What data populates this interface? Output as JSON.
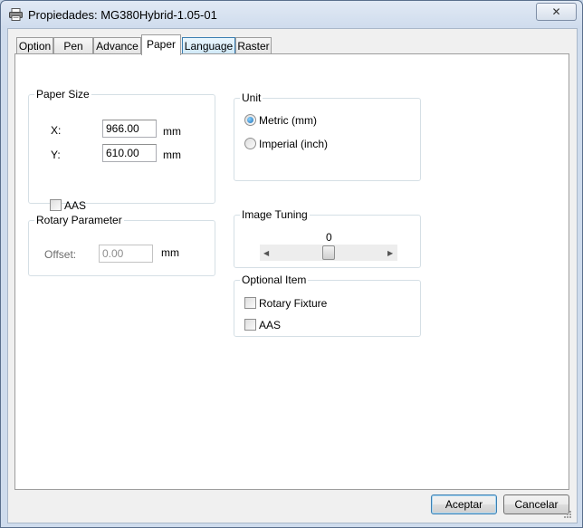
{
  "window": {
    "title": "Propiedades: MG380Hybrid-1.05-01",
    "close_glyph": "✕"
  },
  "tabs": [
    {
      "label": "Option",
      "active": false
    },
    {
      "label": "Pen",
      "active": false
    },
    {
      "label": "Advance",
      "active": false
    },
    {
      "label": "Paper",
      "active": true
    },
    {
      "label": "Language",
      "active": false
    },
    {
      "label": "Raster",
      "active": false
    }
  ],
  "paper_size": {
    "legend": "Paper Size",
    "x_label": "X:",
    "x_value": "966.00",
    "y_label": "Y:",
    "y_value": "610.00",
    "unit": "mm",
    "aas_label": "AAS",
    "aas_checked": false
  },
  "unit": {
    "legend": "Unit",
    "options": [
      {
        "label": "Metric (mm)",
        "selected": true
      },
      {
        "label": "Imperial (inch)",
        "selected": false
      }
    ]
  },
  "rotary": {
    "legend": "Rotary Parameter",
    "offset_label": "Offset:",
    "offset_value": "0.00",
    "unit": "mm"
  },
  "image_tuning": {
    "legend": "Image Tuning",
    "value": "0",
    "position_fraction": 0.5
  },
  "optional_item": {
    "legend": "Optional Item",
    "rotary_fixture_label": "Rotary Fixture",
    "rotary_fixture_checked": false,
    "aas_label": "AAS",
    "aas_checked": false
  },
  "buttons": {
    "ok": "Aceptar",
    "cancel": "Cancelar"
  },
  "colors": {
    "accent": "#3c7fb1",
    "frame": "#c7d6e8"
  }
}
